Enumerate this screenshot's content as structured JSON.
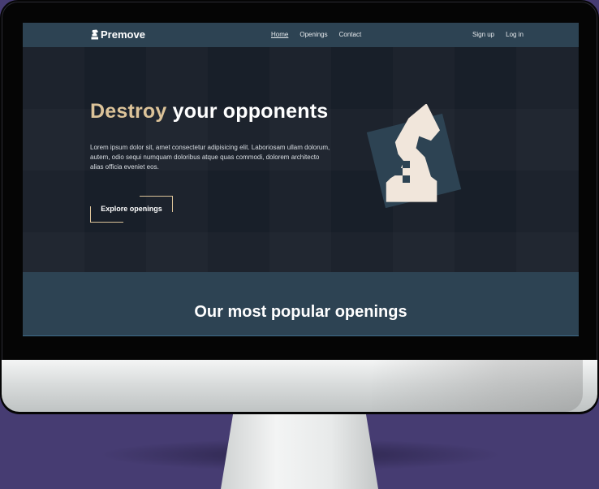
{
  "brand": {
    "name": "Premove",
    "logo_icon": "knight-icon"
  },
  "nav": {
    "links": [
      {
        "label": "Home",
        "active": true
      },
      {
        "label": "Openings",
        "active": false
      },
      {
        "label": "Contact",
        "active": false
      }
    ],
    "auth": [
      {
        "label": "Sign up"
      },
      {
        "label": "Log in"
      }
    ]
  },
  "hero": {
    "headline_accent": "Destroy",
    "headline_rest": " your opponents",
    "lead": "Lorem ipsum dolor sit, amet consectetur adipisicing elit. Laboriosam ullam dolorum, autem, odio sequi numquam doloribus atque quas commodi, dolorem architecto alias officia eveniet eos.",
    "cta_label": "Explore openings",
    "art_icon": "chess-knight-icon"
  },
  "section": {
    "title": "Our most popular openings"
  },
  "colors": {
    "nav_bg": "#2d4353",
    "hero_bg": "#181f29",
    "accent": "#dcc399",
    "knight": "#f1e6db",
    "backdrop": "#463c72"
  }
}
